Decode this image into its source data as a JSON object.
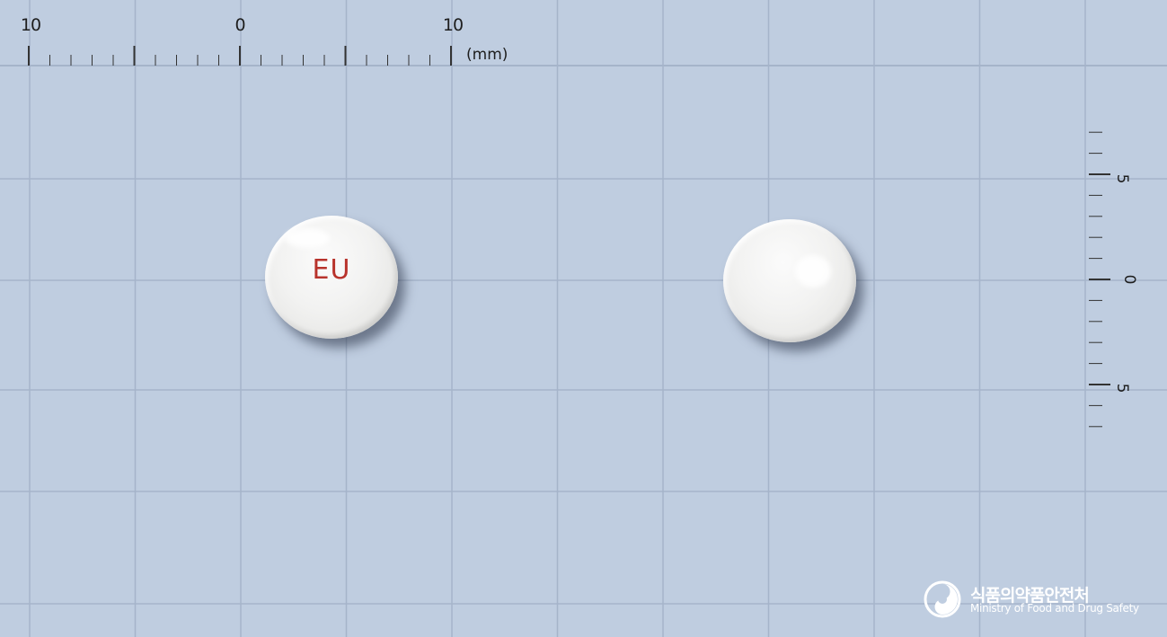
{
  "scale_top": {
    "labels": [
      "10",
      "0",
      "10"
    ],
    "unit": "(mm)"
  },
  "scale_right": {
    "labels": [
      "5",
      "0",
      "5"
    ]
  },
  "pills": [
    {
      "side": "front",
      "imprint": "EU",
      "imprint_color": "#b8332c",
      "color": "#f2f2f1"
    },
    {
      "side": "back",
      "imprint": "",
      "color": "#f2f2f1"
    }
  ],
  "logo": {
    "korean": "식품의약품안전처",
    "english": "Ministry of Food and Drug Safety"
  },
  "colors": {
    "background": "#bfcde0",
    "grid": "#9fafc5",
    "ruler": "#333333"
  }
}
